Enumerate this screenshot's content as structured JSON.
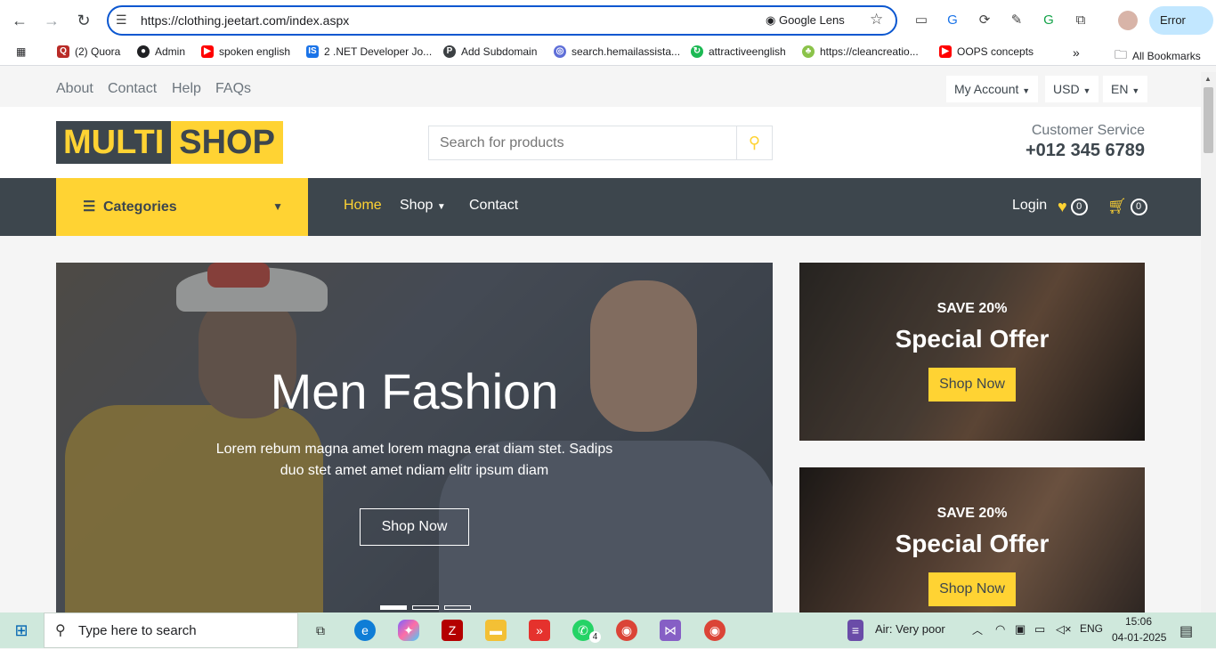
{
  "browser": {
    "url": "https://clothing.jeetart.com/index.aspx",
    "lens_label": "Google Lens",
    "profile_status": "Error"
  },
  "bookmarks": [
    {
      "label": "(2) Quora",
      "color": "#b92b27"
    },
    {
      "label": "Admin",
      "color": "#202124"
    },
    {
      "label": "spoken english",
      "color": "#ff0000"
    },
    {
      "label": "2 .NET Developer Jo...",
      "color": "#1a73e8"
    },
    {
      "label": "Add Subdomain",
      "color": "#3c4043"
    },
    {
      "label": "search.hemailassista...",
      "color": "#5f6fd8"
    },
    {
      "label": "attractiveenglish",
      "color": "#1db954"
    },
    {
      "label": "https://cleancreatio...",
      "color": "#8bc34a"
    },
    {
      "label": "OOPS concepts",
      "color": "#ff0000"
    }
  ],
  "bookmarks_all": "All Bookmarks",
  "site": {
    "topbar": {
      "links": [
        "About",
        "Contact",
        "Help",
        "FAQs"
      ],
      "account": "My Account",
      "currency": "USD",
      "language": "EN"
    },
    "logo": {
      "part1": "MULTI",
      "part2": "SHOP"
    },
    "search": {
      "placeholder": "Search for products"
    },
    "customer_service": {
      "label": "Customer Service",
      "phone": "+012 345 6789"
    },
    "nav": {
      "categories": "Categories",
      "links": [
        "Home",
        "Shop",
        "Contact"
      ],
      "login": "Login",
      "wishlist_count": "0",
      "cart_count": "0"
    },
    "hero": {
      "title": "Men Fashion",
      "text": "Lorem rebum magna amet lorem magna erat diam stet. Sadips duo stet amet amet ndiam elitr ipsum diam",
      "button": "Shop Now"
    },
    "offers": [
      {
        "save": "SAVE 20%",
        "title": "Special Offer",
        "button": "Shop Now"
      },
      {
        "save": "SAVE 20%",
        "title": "Special Offer",
        "button": "Shop Now"
      }
    ],
    "colors": {
      "primary": "#ffd333",
      "dark": "#3d464d"
    }
  },
  "taskbar": {
    "search_placeholder": "Type here to search",
    "air": "Air: Very poor",
    "lang": "ENG",
    "time": "15:06",
    "date": "04-01-2025",
    "whatsapp_badge": "4"
  }
}
